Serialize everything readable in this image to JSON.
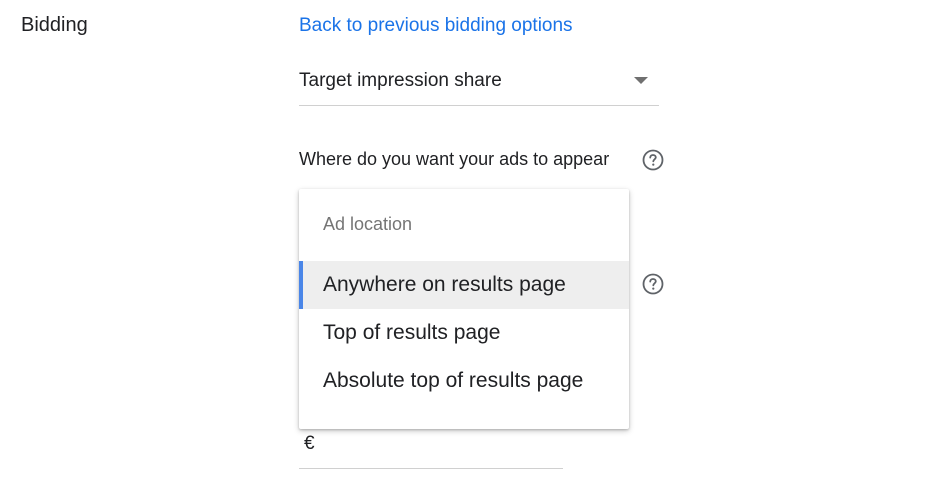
{
  "section": {
    "label": "Bidding"
  },
  "bidding": {
    "back_link": "Back to previous bidding options",
    "strategy_value": "Target impression share",
    "location_question": "Where do you want your ads to appear"
  },
  "dropdown": {
    "header": "Ad location",
    "options": [
      {
        "label": "Anywhere on results page",
        "selected": true
      },
      {
        "label": "Top of results page",
        "selected": false
      },
      {
        "label": "Absolute top of results page",
        "selected": false
      }
    ]
  },
  "currency": {
    "symbol": "€"
  },
  "colors": {
    "link": "#1a73e8",
    "selected_bar": "#4a86e8",
    "selected_bg": "#eeeeee"
  },
  "icons": {
    "help": "help-circle-icon",
    "caret": "caret-down-icon"
  }
}
